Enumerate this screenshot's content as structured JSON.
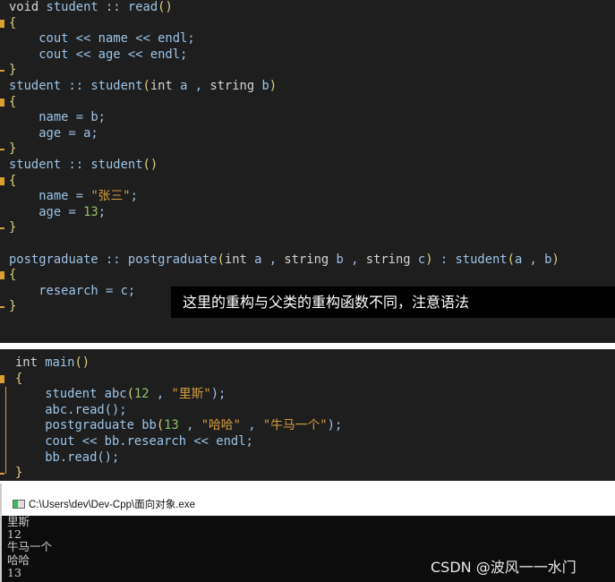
{
  "editor_top": {
    "lines": [
      [
        [
          "void ",
          "kw"
        ],
        [
          "student :: read",
          "id"
        ],
        [
          "()",
          "br"
        ]
      ],
      [
        [
          "{",
          "br"
        ]
      ],
      [
        [
          "    cout << name << endl;",
          "id"
        ]
      ],
      [
        [
          "    cout << age << endl;",
          "id"
        ]
      ],
      [
        [
          "}",
          "br"
        ]
      ],
      [
        [
          "student :: student",
          "id"
        ],
        [
          "(",
          "br"
        ],
        [
          "int ",
          "kw"
        ],
        [
          "a , ",
          "id"
        ],
        [
          "string ",
          "kw"
        ],
        [
          "b",
          "id"
        ],
        [
          ")",
          "br"
        ]
      ],
      [
        [
          "{",
          "br"
        ]
      ],
      [
        [
          "    name = b;",
          "id"
        ]
      ],
      [
        [
          "    age = a;",
          "id"
        ]
      ],
      [
        [
          "}",
          "br"
        ]
      ],
      [
        [
          "student :: student",
          "id"
        ],
        [
          "()",
          "br"
        ]
      ],
      [
        [
          "{",
          "br"
        ]
      ],
      [
        [
          "    name = ",
          "id"
        ],
        [
          "\"张三\"",
          "str"
        ],
        [
          ";",
          "id"
        ]
      ],
      [
        [
          "    age = ",
          "id"
        ],
        [
          "13",
          "num"
        ],
        [
          ";",
          "id"
        ]
      ],
      [
        [
          "}",
          "br"
        ]
      ],
      [],
      [
        [
          "postgraduate :: postgraduate",
          "id"
        ],
        [
          "(",
          "br"
        ],
        [
          "int ",
          "kw"
        ],
        [
          "a , ",
          "id"
        ],
        [
          "string ",
          "kw"
        ],
        [
          "b , ",
          "id"
        ],
        [
          "string ",
          "kw"
        ],
        [
          "c",
          "id"
        ],
        [
          ")",
          "br"
        ],
        [
          " : student",
          "id"
        ],
        [
          "(",
          "br"
        ],
        [
          "a , b",
          "id"
        ],
        [
          ")",
          "br"
        ]
      ],
      [
        [
          "{",
          "br"
        ]
      ],
      [
        [
          "    research = c;",
          "id"
        ]
      ],
      [
        [
          "}",
          "br"
        ]
      ]
    ]
  },
  "annotation": "这里的重构与父类的重构函数不同，注意语法",
  "editor_main": {
    "lines": [
      [
        [
          "int ",
          "kw"
        ],
        [
          "main",
          "id"
        ],
        [
          "()",
          "br"
        ]
      ],
      [
        [
          "{",
          "br"
        ]
      ],
      [
        [
          "    student abc",
          "id"
        ],
        [
          "(",
          "br"
        ],
        [
          "12",
          "num"
        ],
        [
          " , ",
          "id"
        ],
        [
          "\"里斯\"",
          "str"
        ],
        [
          ");",
          "id"
        ]
      ],
      [
        [
          "    abc.read();",
          "id"
        ]
      ],
      [
        [
          "    postgraduate bb",
          "id"
        ],
        [
          "(",
          "br"
        ],
        [
          "13",
          "num"
        ],
        [
          " , ",
          "id"
        ],
        [
          "\"哈哈\"",
          "str"
        ],
        [
          " , ",
          "id"
        ],
        [
          "\"牛马一个\"",
          "str"
        ],
        [
          ");",
          "id"
        ]
      ],
      [
        [
          "    cout << bb.research << endl;",
          "id"
        ]
      ],
      [
        [
          "    bb.read();",
          "id"
        ]
      ],
      [
        [
          "}",
          "br"
        ]
      ]
    ]
  },
  "console": {
    "title": "C:\\Users\\dev\\Dev-Cpp\\面向对象.exe",
    "output": [
      "里斯",
      "12",
      "牛马一个",
      "哈哈",
      "13"
    ]
  },
  "watermark": "CSDN @波风一一水门"
}
